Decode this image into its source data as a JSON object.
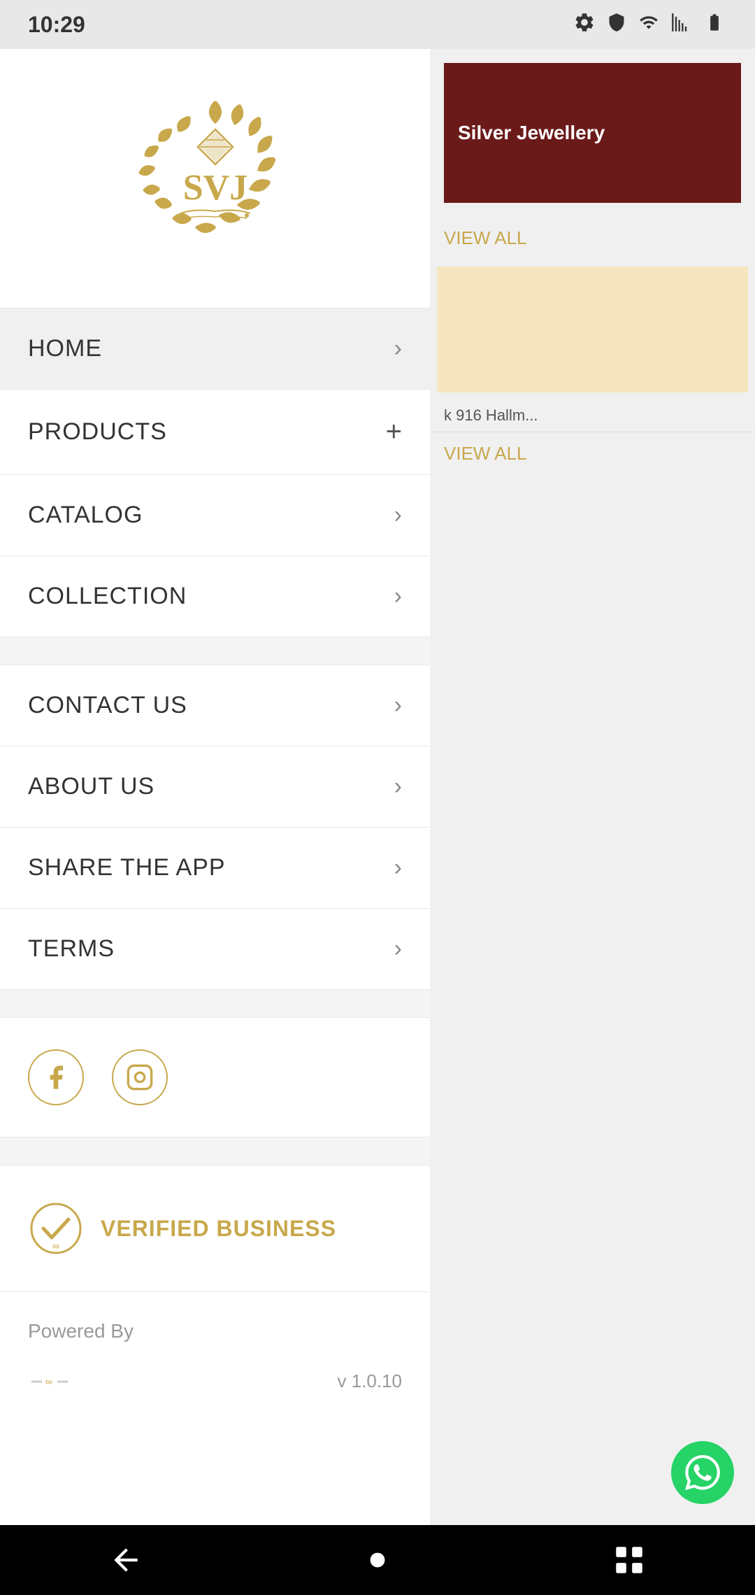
{
  "statusBar": {
    "time": "10:29",
    "icons": [
      "settings",
      "shield",
      "wifi",
      "signal",
      "battery"
    ]
  },
  "logo": {
    "alt": "SVJ Logo",
    "brandColor": "#c8a84b"
  },
  "menu": {
    "items": [
      {
        "id": "home",
        "label": "HOME",
        "icon": "chevron-right",
        "hasPlus": false,
        "active": false
      },
      {
        "id": "products",
        "label": "PRODUCTS",
        "icon": "plus",
        "hasPlus": true,
        "active": false
      },
      {
        "id": "catalog",
        "label": "CATALOG",
        "icon": "chevron-right",
        "hasPlus": false,
        "active": false
      },
      {
        "id": "collection",
        "label": "COLLECTION",
        "icon": "chevron-right",
        "hasPlus": false,
        "active": false
      }
    ],
    "items2": [
      {
        "id": "contact-us",
        "label": "CONTACT US",
        "icon": "chevron-right",
        "active": false
      },
      {
        "id": "about-us",
        "label": "ABOUT US",
        "icon": "chevron-right",
        "active": false
      },
      {
        "id": "share-the-app",
        "label": "SHARE THE APP",
        "icon": "chevron-right",
        "active": false
      },
      {
        "id": "terms",
        "label": "TERMS",
        "icon": "chevron-right",
        "active": false
      }
    ]
  },
  "social": {
    "facebookLabel": "Facebook",
    "instagramLabel": "Instagram"
  },
  "verified": {
    "label": "VERIFIED BUSINESS",
    "color": "#c8a84b"
  },
  "powered": {
    "label": "Powered By"
  },
  "version": {
    "text": "v 1.0.10"
  },
  "navigation": {
    "back": "Back",
    "home": "Home",
    "recent": "Recent"
  },
  "bgContent": {
    "silverText": "Silver Jewellery",
    "viewAll": "VIEW ALL",
    "hallmarkText": "k 916 Hallm...",
    "viewAll2": "VIEW ALL"
  }
}
